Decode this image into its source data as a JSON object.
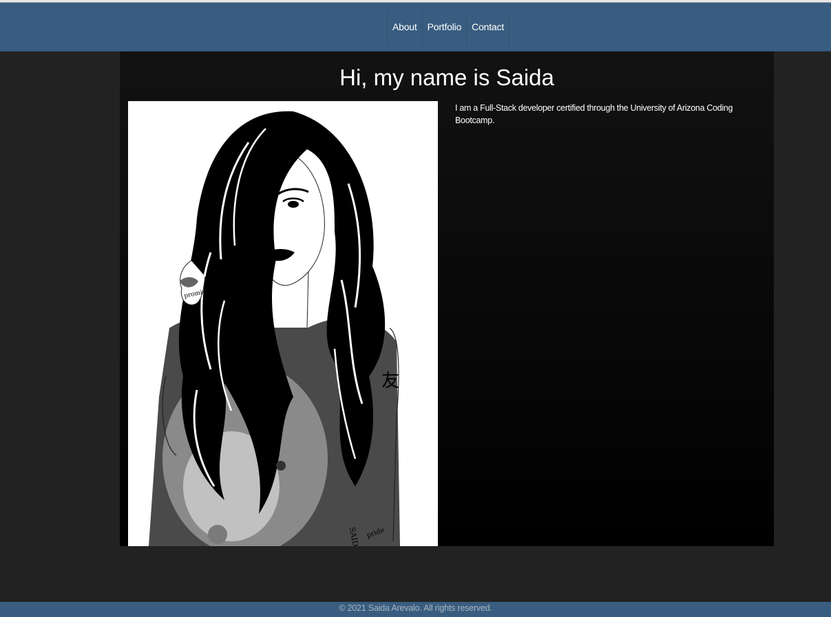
{
  "nav": {
    "items": [
      {
        "label": "About"
      },
      {
        "label": "Portfolio"
      },
      {
        "label": "Contact"
      }
    ]
  },
  "hero": {
    "title": "Hi, my name is Saida",
    "bio": "I am a Full-Stack developer certified through the University of Arizona Coding Bootcamp."
  },
  "portrait": {
    "tattoo_glyph": "友",
    "arm_text": "SAIDA",
    "wrist_text": "pride",
    "hand_text": "promise"
  },
  "footer": {
    "copyright": "© 2021 Saida Arevalo. All rights reserved."
  },
  "colors": {
    "navbar": "#385d80",
    "page_background": "#222222",
    "panel_top": "#121212",
    "panel_bottom": "#000000",
    "text": "#ffffff"
  }
}
